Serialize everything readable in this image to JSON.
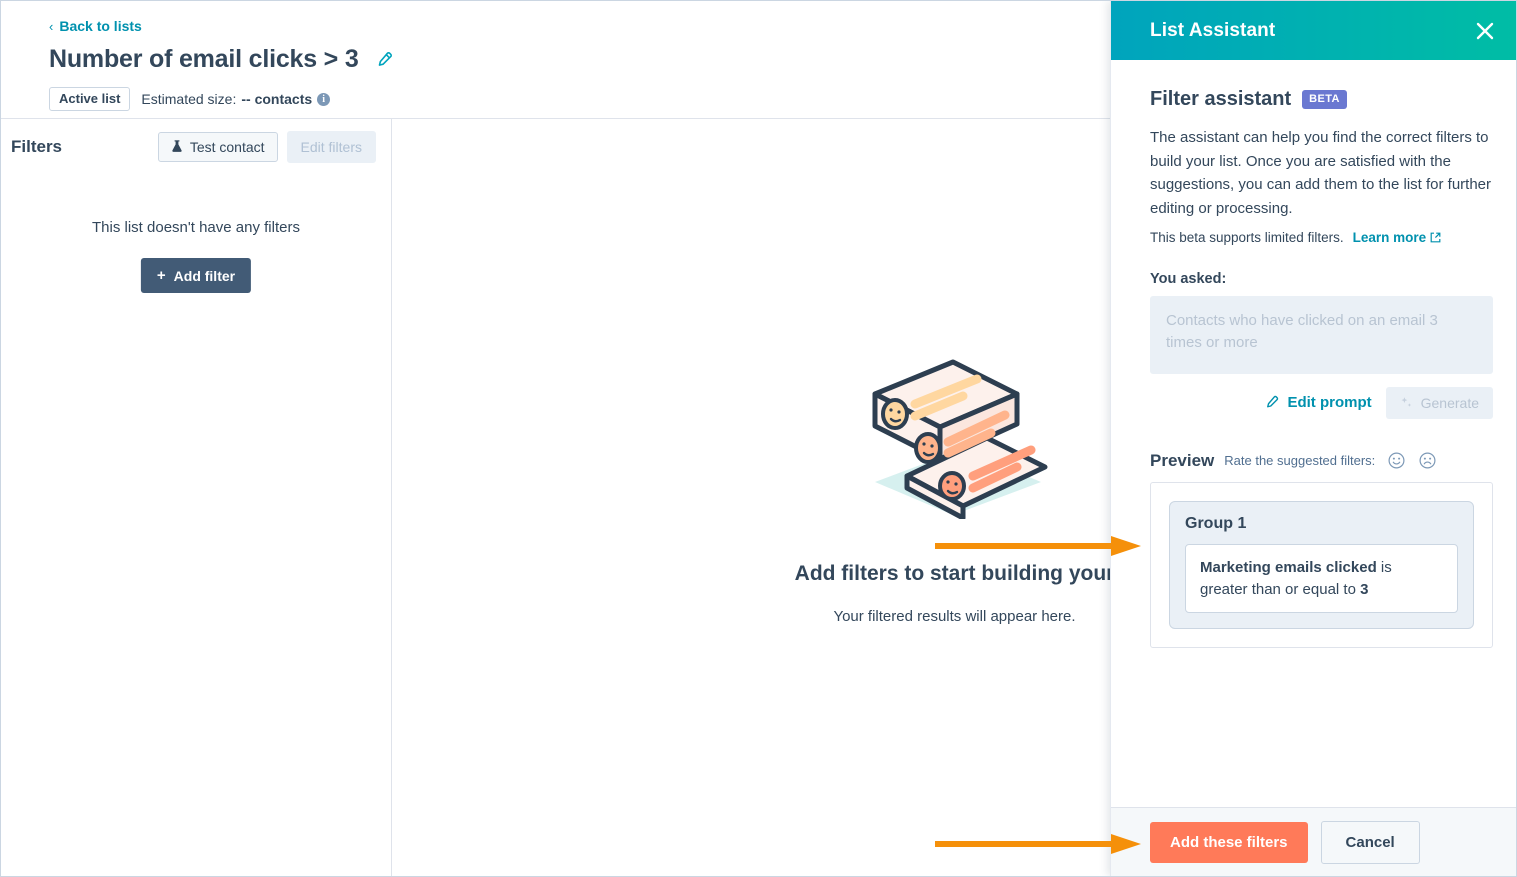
{
  "header": {
    "back_label": "Back to lists",
    "back_icon": "chevron-left-icon",
    "list_title": "Number of email clicks > 3",
    "edit_icon": "pencil-icon",
    "active_badge": "Active list",
    "estimated_label": "Estimated size:",
    "estimated_value": "-- contacts",
    "info_icon": "info-icon",
    "info_glyph": "i"
  },
  "filters_panel": {
    "title": "Filters",
    "test_contact_label": "Test contact",
    "test_contact_icon": "flask-icon",
    "edit_filters_label": "Edit filters",
    "empty_message": "This list doesn't have any filters",
    "add_filter_label": "Add filter",
    "add_filter_icon": "plus-icon"
  },
  "main": {
    "illustration_name": "contact-list-illustration",
    "empty_title": "Add filters to start building your",
    "empty_subtitle": "Your filtered results will appear here."
  },
  "assistant": {
    "panel_title": "List Assistant",
    "close_icon": "close-icon",
    "section_title": "Filter assistant",
    "beta_badge": "BETA",
    "description": "The assistant can help you find the correct filters to build your list. Once you are satisfied with the suggestions, you can add them to the list for further editing or processing.",
    "beta_note": "This beta supports limited filters.",
    "learn_more": "Learn more",
    "learn_more_icon": "external-link-icon",
    "you_asked_label": "You asked:",
    "prompt_value": "Contacts who have clicked on an email 3 times or more",
    "edit_prompt_label": "Edit prompt",
    "edit_prompt_icon": "pencil-icon",
    "generate_label": "Generate",
    "generate_icon": "sparkles-icon",
    "preview_label": "Preview",
    "rate_label": "Rate the suggested filters:",
    "thumbs_up_icon": "happy-face-icon",
    "thumbs_down_icon": "sad-face-icon",
    "preview": {
      "group_title": "Group 1",
      "filter_property": "Marketing emails clicked",
      "filter_operator": " is greater than or equal to ",
      "filter_value": "3"
    },
    "footer": {
      "primary_label": "Add these filters",
      "cancel_label": "Cancel"
    }
  },
  "annotations": {
    "arrow_1_name": "annotation-arrow-preview",
    "arrow_2_name": "annotation-arrow-add-filters"
  },
  "colors": {
    "brand_teal_start": "#00a4bd",
    "brand_teal_end": "#00bda5",
    "accent_orange": "#ff7a59",
    "annotation_orange": "#f5900a",
    "text_dark": "#33475b",
    "link_teal": "#0091ae",
    "beta_purple": "#6a78d1"
  }
}
